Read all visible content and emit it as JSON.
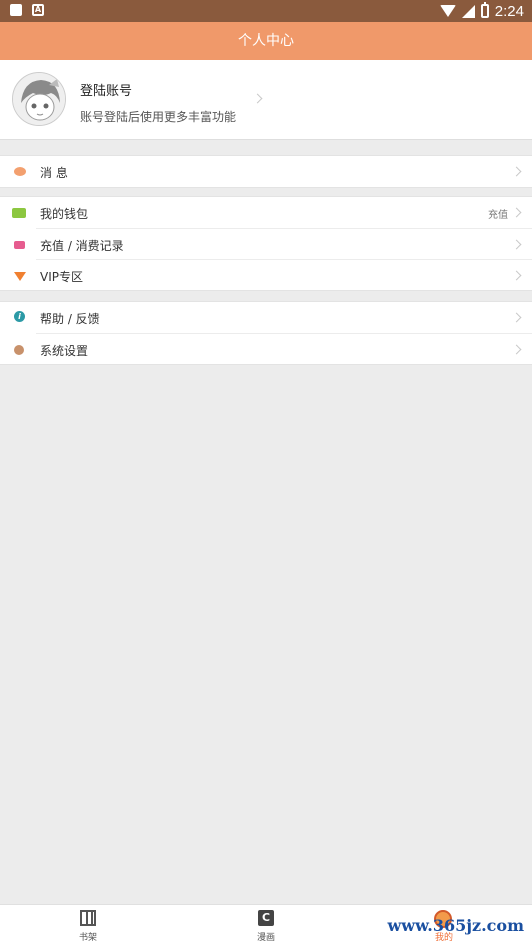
{
  "status_bar": {
    "time": "2:24"
  },
  "header": {
    "title": "个人中心"
  },
  "profile": {
    "name": "登陆账号",
    "description": "账号登陆后使用更多丰富功能"
  },
  "groups": [
    {
      "items": [
        {
          "label": "消 息",
          "icon": "message-icon"
        }
      ]
    },
    {
      "items": [
        {
          "label": "我的钱包",
          "aside": "充值",
          "icon": "wallet-icon"
        },
        {
          "label": "充值 / 消费记录",
          "icon": "record-icon"
        },
        {
          "label": "VIP专区",
          "icon": "diamond-icon"
        }
      ]
    },
    {
      "items": [
        {
          "label": "帮助 / 反馈",
          "icon": "help-icon"
        },
        {
          "label": "系统设置",
          "icon": "gear-icon"
        }
      ]
    }
  ],
  "tabbar": {
    "tabs": [
      {
        "label": "书架",
        "icon": "bookshelf-icon"
      },
      {
        "label": "漫画",
        "icon": "comic-icon",
        "icon_text": "C"
      },
      {
        "label": "我的",
        "icon": "mascot-icon"
      }
    ]
  },
  "watermark": "www.365jz.com"
}
